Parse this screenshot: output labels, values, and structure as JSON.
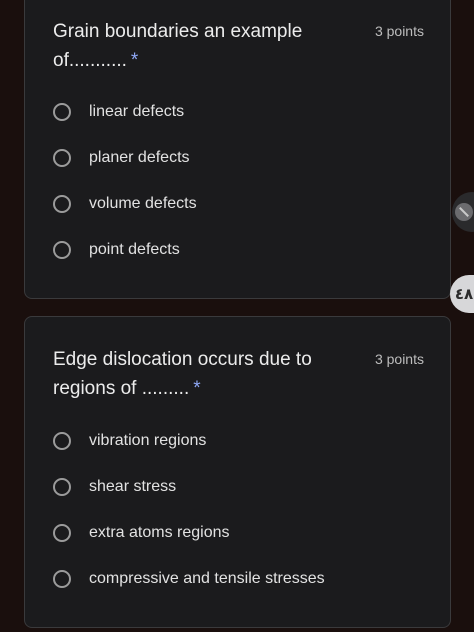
{
  "questions": [
    {
      "title": "Grain boundaries an example of...........",
      "required_mark": "*",
      "points": "3 points",
      "options": [
        {
          "label": "linear defects"
        },
        {
          "label": "planer defects"
        },
        {
          "label": "volume defects"
        },
        {
          "label": "point defects"
        }
      ]
    },
    {
      "title": "Edge dislocation occurs due to regions of .........",
      "required_mark": "*",
      "points": "3 points",
      "options": [
        {
          "label": "vibration regions"
        },
        {
          "label": "shear stress"
        },
        {
          "label": "extra atoms regions"
        },
        {
          "label": "compressive and tensile stresses"
        }
      ]
    }
  ],
  "overlay": {
    "badge_text": "٤٨",
    "side_button_icon": "mic-off-icon"
  },
  "colors": {
    "background": "#1a0f0d",
    "card": "#1b1b1d",
    "required": "#8fa8f5"
  }
}
